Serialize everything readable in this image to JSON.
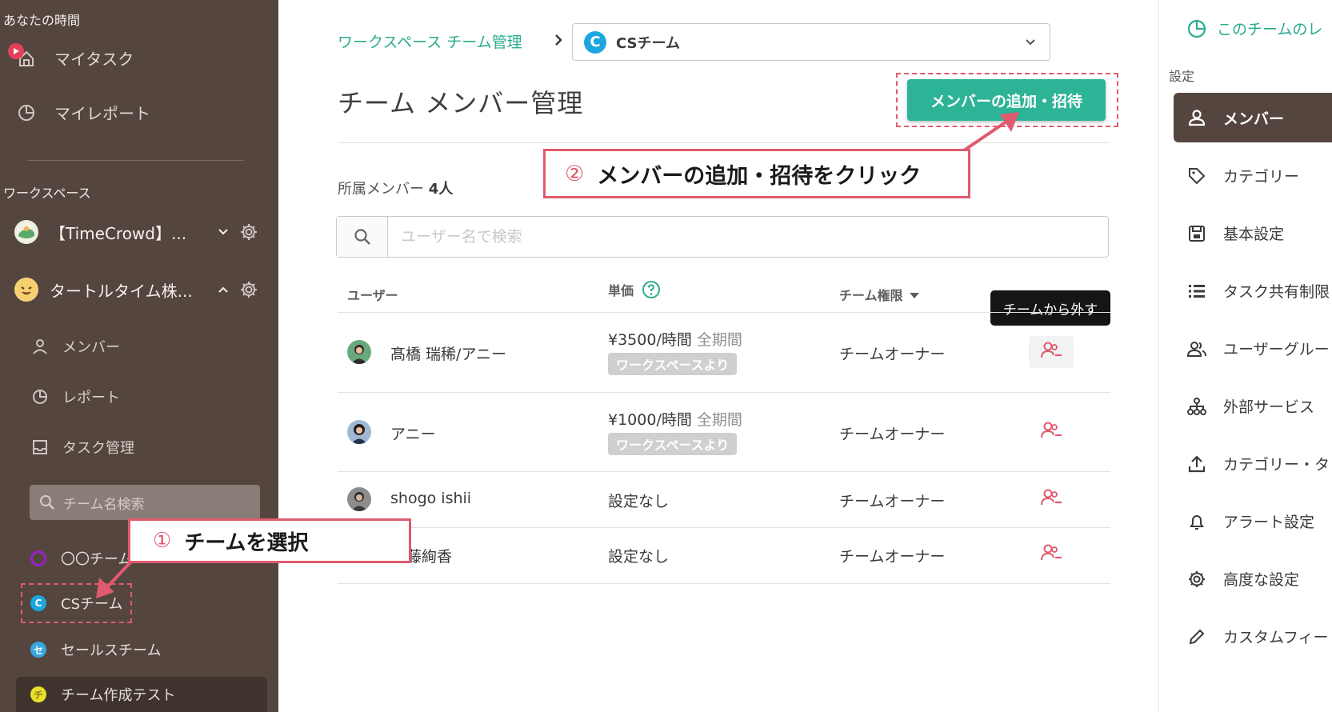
{
  "sidebar": {
    "your_time_heading": "あなたの時間",
    "my_task": "マイタスク",
    "my_report": "マイレポート",
    "workspace_heading": "ワークスペース",
    "workspaces": [
      {
        "name": "【TimeCrowd】..."
      },
      {
        "name": "タートルタイム株..."
      }
    ],
    "sub_items": {
      "members": "メンバー",
      "report": "レポート",
      "task_management": "タスク管理"
    },
    "team_search_placeholder": "チーム名検索",
    "teams": [
      {
        "name": "〇〇チーム",
        "color": "#9b1fc9"
      },
      {
        "name": "CSチーム",
        "initial": "C",
        "color": "#1ca6df"
      },
      {
        "name": "セールスチーム",
        "initial": "セ",
        "color": "#3aa6e0"
      },
      {
        "name": "チーム作成テスト",
        "initial": "チ",
        "color": "#e9e02a"
      }
    ]
  },
  "main": {
    "breadcrumb": "ワークスペース チーム管理",
    "team_select": {
      "initial": "C",
      "value": "CSチーム"
    },
    "page_title": "チーム メンバー管理",
    "add_button": "メンバーの追加・招待",
    "member_count_label": "所属メンバー",
    "member_count_value": "4人",
    "search_placeholder": "ユーザー名で検索",
    "columns": {
      "user": "ユーザー",
      "price": "単価",
      "role": "チーム権限"
    },
    "tooltip": "チームから外す",
    "members": [
      {
        "name": "髙橋 瑞稀/アニー",
        "price": "¥3500/時間",
        "period": "全期間",
        "tag": "ワークスペースより",
        "role": "チームオーナー"
      },
      {
        "name": "アニー",
        "price": "¥1000/時間",
        "period": "全期間",
        "tag": "ワークスペースより",
        "role": "チームオーナー"
      },
      {
        "name": "shogo ishii",
        "price": "設定なし",
        "role": "チームオーナー"
      },
      {
        "name": "藤絢香",
        "price": "設定なし",
        "role": "チームオーナー"
      }
    ]
  },
  "right_panel": {
    "team_report_link": "このチームのレ",
    "settings_heading": "設定",
    "items": [
      "メンバー",
      "カテゴリー",
      "基本設定",
      "タスク共有制限",
      "ユーザーグルー",
      "外部サービス",
      "カテゴリー・タ",
      "アラート設定",
      "高度な設定",
      "カスタムフィー"
    ]
  },
  "callouts": {
    "step1_num": "①",
    "step1_text": "チームを選択",
    "step2_num": "②",
    "step2_text": "メンバーの追加・招待をクリック"
  },
  "colors": {
    "sidebar_bg": "#54463f",
    "accent_green": "#2db396",
    "callout_red": "#e05a6e",
    "remove_icon_red": "#e05a6e"
  }
}
